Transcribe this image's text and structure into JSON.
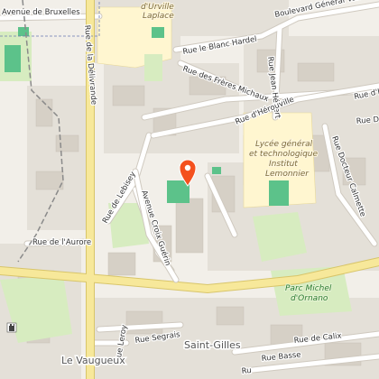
{
  "colors": {
    "background": "#f2efe9",
    "block": "#e4e0d8",
    "building": "#d6d0c6",
    "road": "#ffffff",
    "road_outline": "#cfc9bf",
    "primary_road": "#f7e89a",
    "primary_road_outline": "#d8c56a",
    "park": "#d7ecc0",
    "sports": "#5cc28a",
    "school_area": "#fff6d0",
    "rail": "#8a8a8a",
    "marker": "#f4511e"
  },
  "streets": {
    "bruxelles": "Avenue de Bruxelles",
    "delivrande": "Rue de la Délivrande",
    "blanc_hardel": "Rue le Blanc Hardel",
    "vanier": "Boulevard Général Vanier",
    "freres": "Rue des Frères Michaux",
    "jean": "Rue Jean Hébert",
    "herouville_center": "Rue d'Hérouville",
    "herouville_right": "Rue d'Hé",
    "docteur_top": "Rue Do",
    "docteur_right": "Rue Docteur Calmette",
    "lebisey": "Rue de Lebisey",
    "croix": "Avenue Croix Guérin",
    "aurore": "Rue de l'Aurore",
    "segrais": "Rue Segrais",
    "leroy": "Rue Leroy",
    "basse": "Rue Basse",
    "calix": "Rue de Calix",
    "ru": "Ru"
  },
  "poi": {
    "urville_line1": "d'Urville",
    "urville_line2": "Laplace",
    "lycee_line1": "Lycée général",
    "lycee_line2": "et technologique",
    "lycee_line3": "Institut",
    "lycee_line4": "Lemonnier"
  },
  "parks": {
    "ornano_line1": "Parc Michel",
    "ornano_line2": "d'Ornano"
  },
  "districts": {
    "saint_gilles": "Saint-Gilles",
    "vaugueux": "Le Vaugueux"
  },
  "icons": {
    "marker": "location-pin-icon",
    "castle": "castle-icon"
  }
}
